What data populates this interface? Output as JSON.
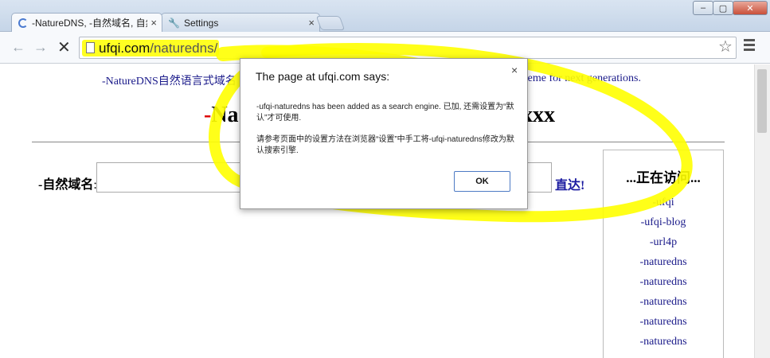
{
  "browser": {
    "tabs": [
      {
        "title": "-NatureDNS, -自然域名, 自然",
        "close": "×",
        "icon": "loading-spinner-icon",
        "active": true
      },
      {
        "title": "Settings",
        "close": "×",
        "icon": "wrench-icon",
        "active": false
      }
    ],
    "window_buttons": {
      "minimize": "–",
      "maximize": "▢",
      "close": "✕"
    },
    "nav": {
      "back": "←",
      "forward": "→",
      "stop": "✕"
    },
    "url": {
      "host": "ufqi.com",
      "path": "/naturedns/"
    },
    "star": "☆"
  },
  "page": {
    "tagline_left": "-NatureDNS自然语言式域名",
    "tagline_right": "scheme for next generations.",
    "title_left_dash": "-",
    "title_left": "Na",
    "title_right": "xxx",
    "search": {
      "label": "-自然域名",
      "colon": ":",
      "value": "",
      "go_label": "直达!"
    },
    "sidebar": {
      "title": "...正在访问...",
      "items": [
        "-ufqi",
        "-ufqi-blog",
        "-url4p",
        "-naturedns",
        "-naturedns",
        "-naturedns",
        "-naturedns",
        "-naturedns"
      ]
    }
  },
  "dialog": {
    "title": "The page at ufqi.com says:",
    "close": "×",
    "message1": "-ufqi-naturedns has been added as a search engine. 已加, 还需设置为“默认”才可使用.",
    "message2": "请参考页面中的设置方法在浏览器“设置”中手工将-ufqi-naturedns修改为默认搜索引擎.",
    "ok_label": "OK"
  },
  "colors": {
    "highlight": "#ffff22",
    "link": "#1a1a8a",
    "title_dash": "#dd0000"
  }
}
